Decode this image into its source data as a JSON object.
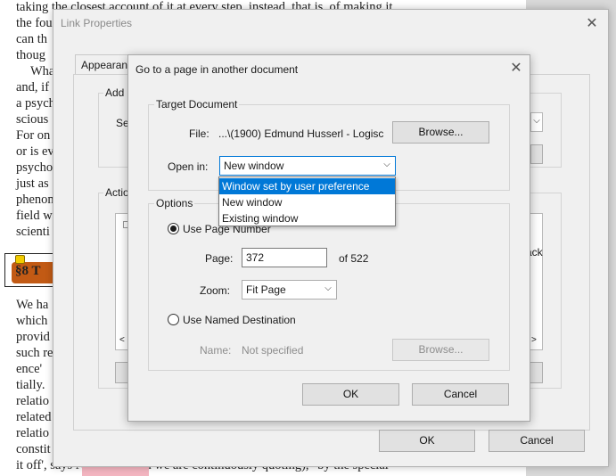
{
  "background_document": {
    "lines": [
      "taking the closest account of it at every step, instead, that is, of making it",
      "the fou",
      "can th",
      "thoug",
      "Wha",
      "and, if",
      "a psych",
      "scious",
      "For on",
      "or is ev",
      "psycho",
      "just as",
      "phenon",
      "field w",
      "scienti",
      "We ha",
      "which",
      "provid",
      "such re",
      "ence' ",
      "tially.",
      "relatio",
      "related",
      "relatio",
      "constit",
      "it off', says Natorp (whom we are continuously quoting), \"by the special"
    ],
    "section_heading": "§8 T"
  },
  "link_properties": {
    "title": "Link Properties",
    "tab_appearance": "Appearanc",
    "group_add_label": "Add a",
    "select_label": "Sel",
    "group_actions_label": "Actio",
    "list_fragment": "ack",
    "ok_label": "OK",
    "cancel_label": "Cancel"
  },
  "goto_dialog": {
    "title": "Go to a page in another document",
    "target_group_label": "Target Document",
    "file_label": "File:",
    "file_value": "...\\(1900) Edmund Husserl - Logisc",
    "browse_label": "Browse...",
    "open_in_label": "Open in:",
    "open_in_value": "New window",
    "open_in_options": [
      "Window set by user preference",
      "New window",
      "Existing window"
    ],
    "open_in_highlighted": "Window set by user preference",
    "options_group_label": "Options",
    "use_page_number_label": "Use Page Number",
    "page_label": "Page:",
    "page_value": "372",
    "page_total": "of 522",
    "zoom_label": "Zoom:",
    "zoom_value": "Fit Page",
    "use_named_dest_label": "Use Named Destination",
    "name_label": "Name:",
    "name_value": "Not specified",
    "browse_disabled_label": "Browse...",
    "ok_label": "OK",
    "cancel_label": "Cancel"
  },
  "colors": {
    "accent": "#0078d7",
    "heading_highlight": "#c25a14"
  }
}
